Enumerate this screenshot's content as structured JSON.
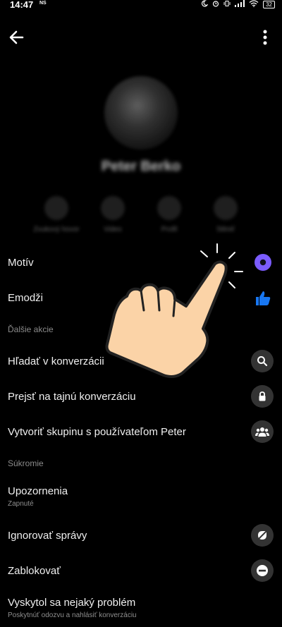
{
  "status": {
    "time": "14:47",
    "ns": "NS",
    "battery": "32"
  },
  "profile": {
    "name": "Peter Berko",
    "actions": [
      "Zvukový hovor",
      "Video",
      "Profil",
      "Stlmiť"
    ]
  },
  "settings": {
    "theme_label": "Motív",
    "emoji_label": "Emodži",
    "section_more": "Ďalšie akcie",
    "search_label": "Hľadať v konverzácii",
    "secret_label": "Prejsť na tajnú konverzáciu",
    "group_label": "Vytvoriť skupinu s používateľom Peter",
    "section_privacy": "Súkromie",
    "notifications_label": "Upozornenia",
    "notifications_sub": "Zapnuté",
    "ignore_label": "Ignorovať správy",
    "block_label": "Zablokovať",
    "problem_label": "Vyskytol sa nejaký problém",
    "problem_sub": "Poskytnúť odozvu a nahlásiť konverzáciu"
  },
  "colors": {
    "theme_accent": "#7b5cff",
    "like_blue": "#1877f2",
    "hand_fill": "#fbd3a7"
  },
  "icons": {
    "theme": "theme-circle-icon",
    "emoji": "thumbs-up-icon",
    "search": "search-icon",
    "secret": "lock-icon",
    "group": "people-icon",
    "ignore": "ignore-slash-icon",
    "block": "block-minus-icon"
  }
}
